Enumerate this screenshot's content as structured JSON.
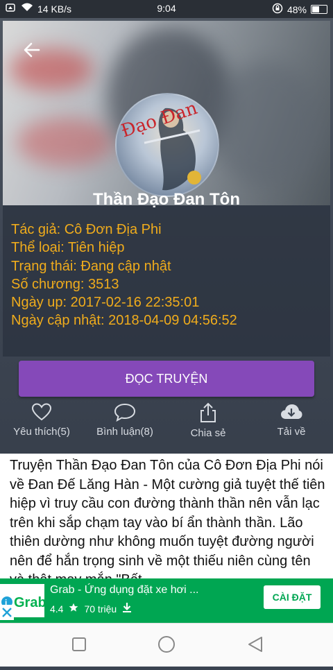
{
  "status_bar": {
    "speed": "14 KB/s",
    "time": "9:04",
    "battery": "48%"
  },
  "book": {
    "title": "Thần Đạo Đan Tôn",
    "author": "Tác giả: Cô Đơn Địa Phi",
    "genre": "Thể loại: Tiên hiệp",
    "status": "Trạng thái: Đang cập nhật",
    "chapters": "Số chương: 3513",
    "upload_date": "Ngày up: 2017-02-16 22:35:01",
    "updated_date": "Ngày cập nhật: 2018-04-09 04:56:52",
    "cover_text": "Đạo Đan"
  },
  "read_button": "ĐỌC TRUYỆN",
  "actions": {
    "favorite": "Yêu thích(5)",
    "comment": "Bình luận(8)",
    "share": "Chia sẻ",
    "download": "Tải về"
  },
  "description": "Truyện Thần Đạo Đan Tôn của Cô Đơn Địa Phi nói về Đan Đế Lăng Hàn - Một cường giả tuyệt thế tiên hiệp vì truy cầu con đường thành thần nên vẫn lạc trên khi sắp chạm tay vào bí ẩn thành thần. Lão thiên dường như không muốn tuyệt đường người nên để hắn trọng sinh về một thiếu niên cùng tên và thật may mắn \"Bất",
  "ad": {
    "logo_text": "Grab",
    "title": "Grab - Ứng dụng đặt xe hơi ...",
    "rating": "4.4",
    "downloads": "70 triệu",
    "install": "CÀI ĐẶT"
  },
  "colors": {
    "accent": "#8549b9",
    "meta": "#f0ac1c",
    "ad_green": "#00a652"
  }
}
